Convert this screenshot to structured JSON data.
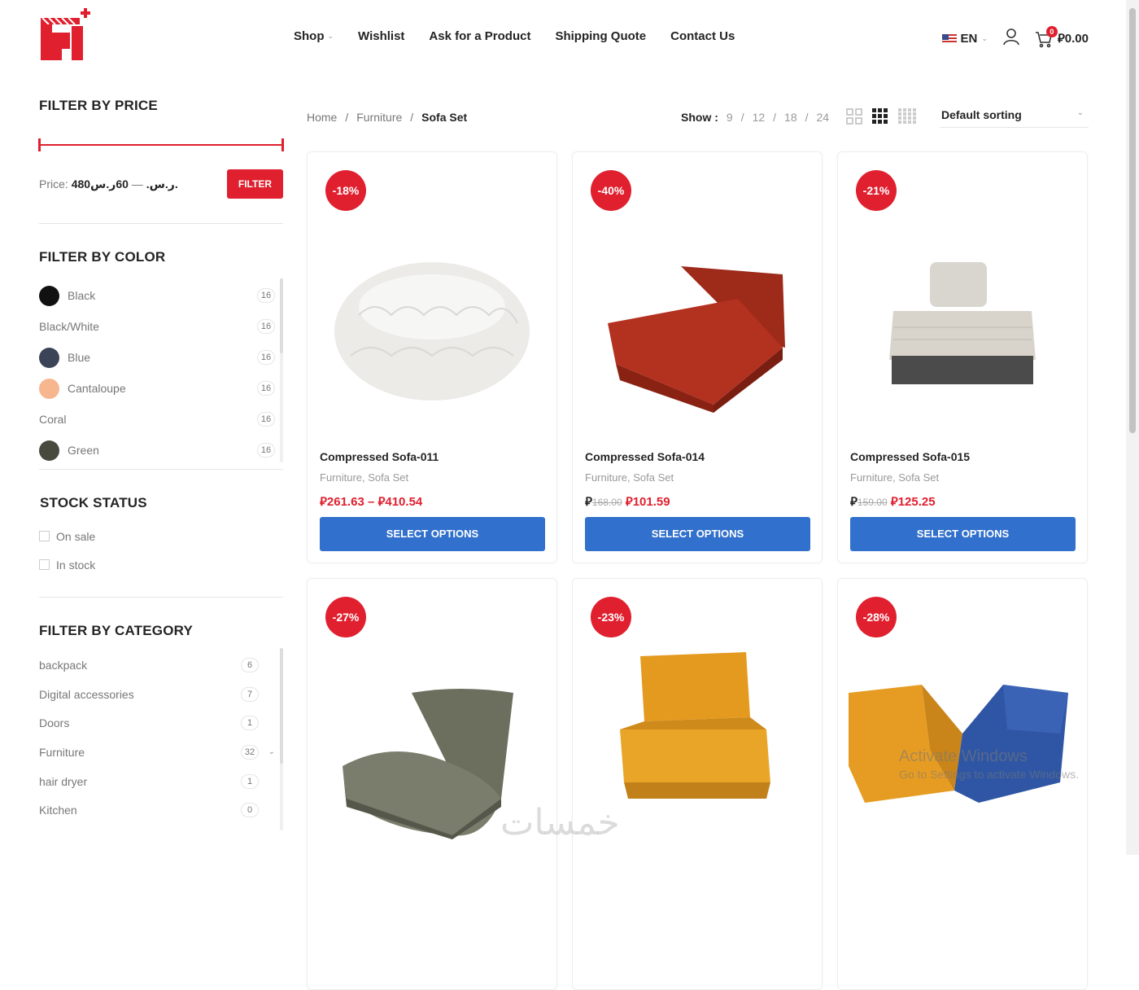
{
  "header": {
    "nav": [
      {
        "label": "Shop",
        "has_dropdown": true
      },
      {
        "label": "Wishlist"
      },
      {
        "label": "Ask for a Product"
      },
      {
        "label": "Shipping Quote"
      },
      {
        "label": "Contact Us"
      }
    ],
    "language": "EN",
    "cart_count": "0",
    "cart_total": "⃁0.00",
    "accent_color": "#e0202f"
  },
  "sidebar": {
    "price": {
      "title": "FILTER BY PRICE",
      "label": "Price:",
      "min": "480ر.س.",
      "dash": "—",
      "max": "60ر.س.",
      "button": "FILTER"
    },
    "color": {
      "title": "FILTER BY COLOR",
      "items": [
        {
          "label": "Black",
          "count": "16",
          "swatch": "#111111"
        },
        {
          "label": "Black/White",
          "count": "16",
          "swatch": ""
        },
        {
          "label": "Blue",
          "count": "16",
          "swatch": "#3b4457"
        },
        {
          "label": "Cantaloupe",
          "count": "16",
          "swatch": "#f7b68d"
        },
        {
          "label": "Coral",
          "count": "16",
          "swatch": ""
        },
        {
          "label": "Green",
          "count": "16",
          "swatch": "#474a3d"
        }
      ]
    },
    "stock": {
      "title": "STOCK STATUS",
      "items": [
        "On sale",
        "In stock"
      ]
    },
    "category": {
      "title": "FILTER BY CATEGORY",
      "items": [
        {
          "label": "backpack",
          "count": "6"
        },
        {
          "label": "Digital accessories",
          "count": "7"
        },
        {
          "label": "Doors",
          "count": "1"
        },
        {
          "label": "Furniture",
          "count": "32",
          "expandable": true
        },
        {
          "label": "hair dryer",
          "count": "1"
        },
        {
          "label": "Kitchen",
          "count": "0"
        }
      ]
    }
  },
  "toolbar": {
    "breadcrumb": [
      "Home",
      "Furniture",
      "Sofa Set"
    ],
    "show_label": "Show :",
    "show_options": [
      "9",
      "12",
      "18",
      "24"
    ],
    "sorting": "Default sorting"
  },
  "products": [
    {
      "discount": "-18%",
      "name": "Compressed Sofa-011",
      "categories": "Furniture, Sofa Set",
      "old_price": "",
      "price": "⃁261.63 – ⃁410.54",
      "button": "SELECT OPTIONS",
      "color": "#ecebe8",
      "shape": "round"
    },
    {
      "discount": "-40%",
      "name": "Compressed Sofa-014",
      "categories": "Furniture, Sofa Set",
      "old_price": "168.00",
      "price": "⃁101.59",
      "button": "SELECT OPTIONS",
      "color": "#b3311f",
      "shape": "chair"
    },
    {
      "discount": "-21%",
      "name": "Compressed Sofa-015",
      "categories": "Furniture, Sofa Set",
      "old_price": "159.00",
      "price": "⃁125.25",
      "button": "SELECT OPTIONS",
      "color": "#d8d4cc",
      "shape": "ottoman"
    },
    {
      "discount": "-27%",
      "name": "",
      "categories": "",
      "old_price": "",
      "price": "",
      "button": "",
      "color": "#6d6f5e",
      "shape": "lounger"
    },
    {
      "discount": "-23%",
      "name": "",
      "categories": "",
      "old_price": "",
      "price": "",
      "button": "",
      "color": "#e39a1e",
      "shape": "chair2"
    },
    {
      "discount": "-28%",
      "name": "",
      "categories": "",
      "old_price": "",
      "price": "",
      "button": "",
      "color": "#e69c22",
      "shape": "pair"
    }
  ],
  "os_watermark": {
    "title": "Activate Windows",
    "subtitle": "Go to Settings to activate Windows."
  },
  "site_watermark": "خمسات"
}
